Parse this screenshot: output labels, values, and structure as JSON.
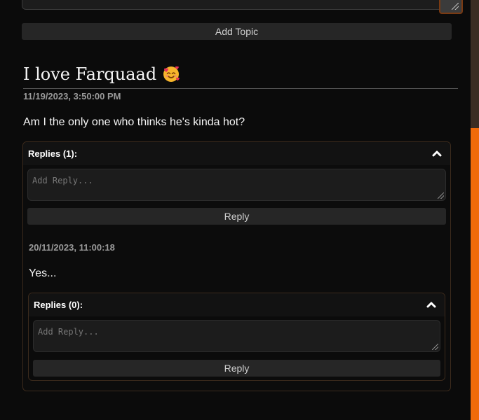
{
  "top_form": {
    "add_topic_label": "Add Topic"
  },
  "topic": {
    "title": "I love Farquaad",
    "emoji": "smiling-face-with-hearts",
    "date": "11/19/2023, 3:50:00 PM",
    "body": "Am I the only one who thinks he's kinda hot?"
  },
  "replies": {
    "header": "Replies (1):",
    "input_placeholder": "Add Reply...",
    "reply_button": "Reply",
    "items": [
      {
        "date": "20/11/2023, 11:00:18",
        "text": "Yes...",
        "replies": {
          "header": "Replies (0):",
          "input_placeholder": "Add Reply...",
          "reply_button": "Reply"
        }
      }
    ]
  },
  "colors": {
    "accent": "#f06a0a",
    "background": "#0b0b0b",
    "panel_border": "#3b2a1c"
  },
  "icons": {
    "collapse": "chevron-up-icon",
    "resize": "resize-grip-icon"
  }
}
